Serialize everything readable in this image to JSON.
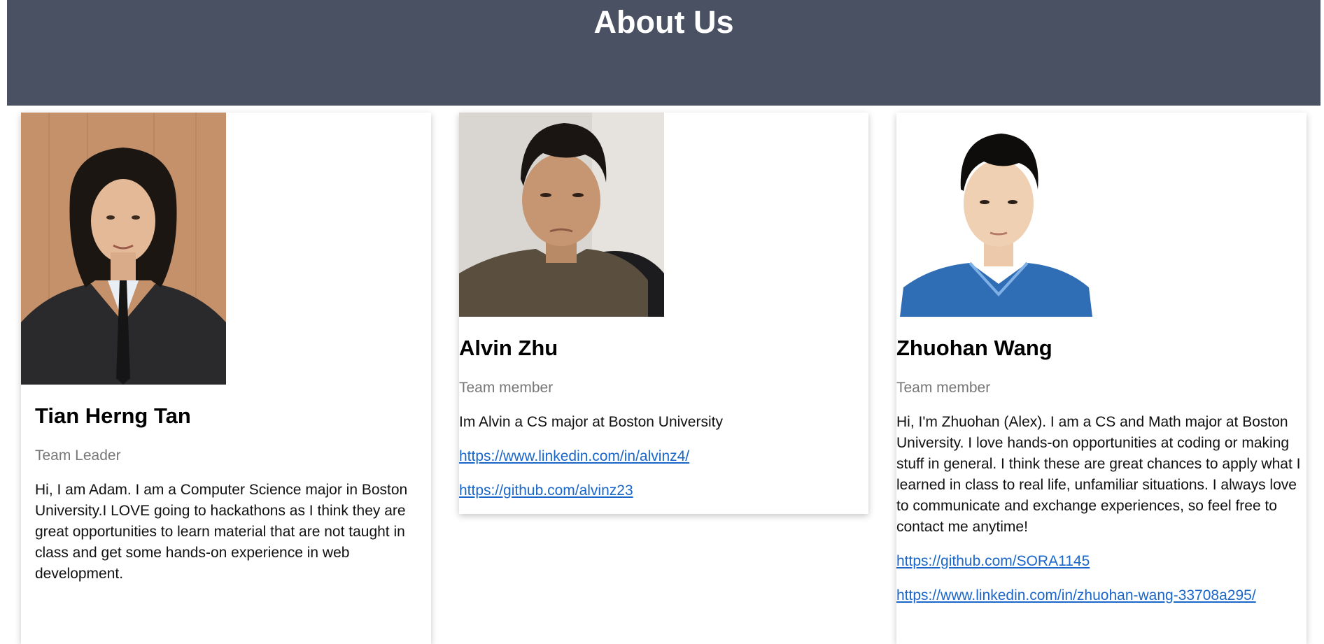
{
  "page": {
    "title": "About Us"
  },
  "colors": {
    "header_bg": "#4a5162",
    "header_text": "#ffffff",
    "role_text": "#777777",
    "link": "#1a66c9"
  },
  "team": [
    {
      "photo_icon": "person-photo",
      "name": "Tian Herng Tan",
      "role": "Team Leader",
      "bio": "Hi, I am Adam. I am a Computer Science major in Boston University.I LOVE going to hackathons as I think they are great opportunities to learn material that are not taught in class and get some hands-on experience in web development.",
      "links": []
    },
    {
      "photo_icon": "person-photo",
      "name": "Alvin Zhu",
      "role": "Team member",
      "bio": "Im Alvin a CS major at Boston University",
      "links": [
        "https://www.linkedin.com/in/alvinz4/",
        "https://github.com/alvinz23"
      ]
    },
    {
      "photo_icon": "person-photo",
      "name": "Zhuohan Wang",
      "role": "Team member",
      "bio": "Hi, I'm Zhuohan (Alex). I am a CS and Math major at Boston University. I love hands-on opportunities at coding or making stuff in general. I think these are great chances to apply what I learned in class to real life, unfamiliar situations. I always love to communicate and exchange experiences, so feel free to contact me anytime!",
      "links": [
        "https://github.com/SORA1145",
        "https://www.linkedin.com/in/zhuohan-wang-33708a295/"
      ]
    }
  ]
}
